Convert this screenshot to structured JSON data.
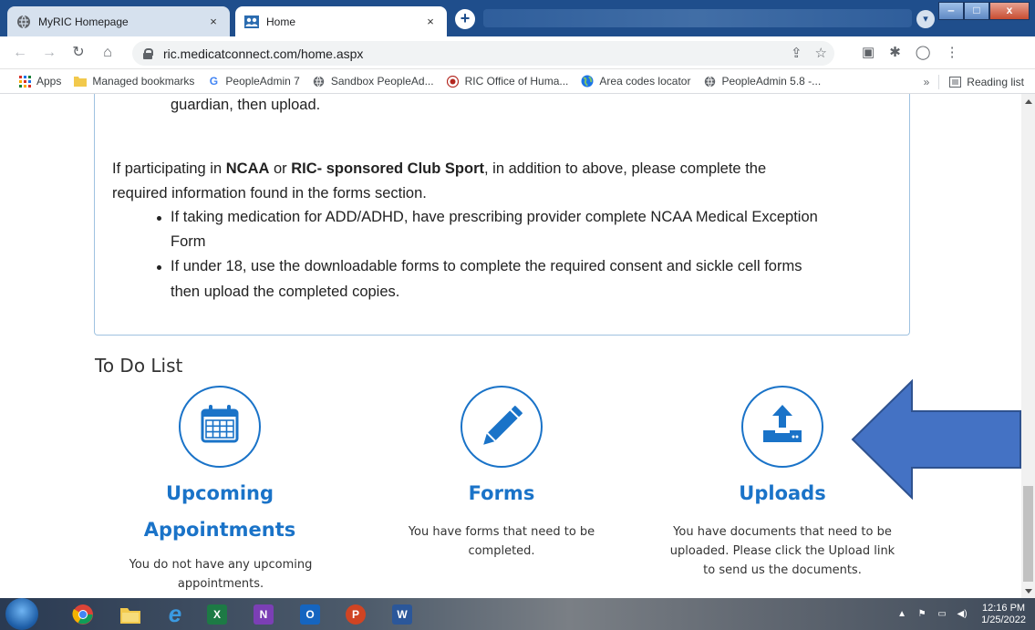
{
  "browser": {
    "tabs": [
      {
        "title": "MyRIC Homepage",
        "active": false,
        "close": "×"
      },
      {
        "title": "Home",
        "active": true,
        "close": "×"
      }
    ],
    "new_tab": "+",
    "url": "ric.medicatconnect.com/home.aspx",
    "window_buttons": {
      "minimize": "‒",
      "maximize": "□",
      "close": "x"
    }
  },
  "bookmarks": {
    "items": [
      {
        "label": "Apps",
        "icon": "apps-grid-icon"
      },
      {
        "label": "Managed bookmarks",
        "icon": "folder-icon"
      },
      {
        "label": "PeopleAdmin 7",
        "icon": "google-icon"
      },
      {
        "label": "Sandbox PeopleAd...",
        "icon": "globe-icon"
      },
      {
        "label": "RIC Office of Huma...",
        "icon": "ric-icon"
      },
      {
        "label": "Area codes locator",
        "icon": "earth-icon"
      },
      {
        "label": "PeopleAdmin 5.8 -...",
        "icon": "globe-icon"
      }
    ],
    "more": "»",
    "reading_list": "Reading list"
  },
  "info_box": {
    "lines": {
      "guardian": "guardian, then upload.",
      "ncaa_prefix": "If participating in ",
      "ncaa_bold1": "NCAA",
      "ncaa_or": " or ",
      "ncaa_bold2": "RIC- sponsored Club Sport",
      "ncaa_suffix": ", in addition to above, please complete the",
      "required": "required information found in the forms section.",
      "bullet1_a": "If taking medication for ADD/ADHD, have prescribing provider complete NCAA Medical Exception",
      "bullet1_b": "Form",
      "bullet2_a": "If under 18, use the downloadable forms to complete the required consent and sickle cell forms",
      "bullet2_b": "then upload the completed copies."
    }
  },
  "todo": {
    "title": "To Do List",
    "cards": {
      "appointments": {
        "heading_line1": "Upcoming",
        "heading_line2": "Appointments",
        "text_line1": "You do not have any upcoming",
        "text_line2": "appointments.",
        "icon": "calendar-icon"
      },
      "forms": {
        "heading": "Forms",
        "text_line1": "You have forms that need to be",
        "text_line2": "completed.",
        "icon": "pencil-icon"
      },
      "uploads": {
        "heading": "Uploads",
        "text_line1": "You have documents that need to be",
        "text_line2": "uploaded. Please click the Upload link",
        "text_line3": "to send us the documents.",
        "icon": "upload-icon"
      }
    }
  },
  "taskbar": {
    "apps": [
      "chrome-icon",
      "file-explorer-icon",
      "internet-explorer-icon",
      "excel-icon",
      "onenote-icon",
      "outlook-icon",
      "powerpoint-icon",
      "word-icon"
    ],
    "time": "12:16 PM",
    "date": "1/25/2022"
  },
  "colors": {
    "accent": "#1a73c8",
    "arrow_fill": "#4472c4",
    "arrow_stroke": "#2f528f",
    "box_border": "#9fc2e0"
  }
}
